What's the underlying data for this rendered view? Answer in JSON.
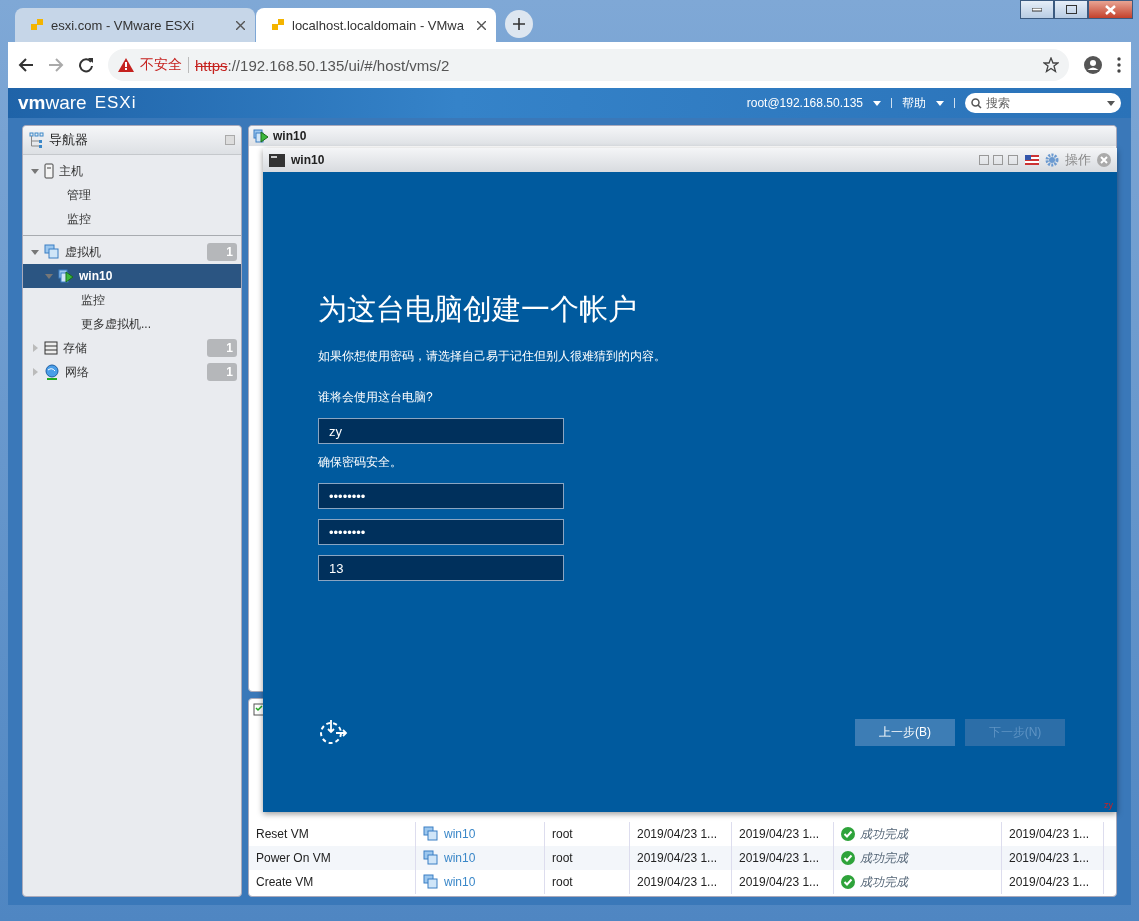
{
  "browser": {
    "tabs": [
      {
        "title": "esxi.com - VMware ESXi",
        "selected": false
      },
      {
        "title": "localhost.localdomain - VMwa",
        "selected": true
      }
    ],
    "address": {
      "security": "不安全",
      "scheme": "https",
      "rest": "://192.168.50.135/ui/#/host/vms/2"
    }
  },
  "esxi_header": {
    "logo_vm": "vm",
    "logo_ware": "ware",
    "product": "ESXi",
    "user": "root@192.168.50.135",
    "help": "帮助",
    "search": {
      "placeholder": "搜索"
    }
  },
  "navigator": {
    "title": "导航器",
    "items": [
      {
        "label": "主机",
        "kind": "host",
        "expanded": true,
        "selected": false,
        "children": [
          {
            "label": "管理",
            "selected": false
          },
          {
            "label": "监控",
            "selected": false
          }
        ]
      },
      {
        "label": "虚拟机",
        "kind": "vms",
        "expanded": true,
        "badge": "1",
        "selected": false,
        "children": [
          {
            "label": "win10",
            "kind": "vm",
            "expanded": true,
            "selected": true,
            "children": [
              {
                "label": "监控",
                "selected": false
              },
              {
                "label": "更多虚拟机...",
                "selected": false
              }
            ]
          }
        ]
      },
      {
        "label": "存储",
        "kind": "storage",
        "expanded": false,
        "badge": "1",
        "selected": false
      },
      {
        "label": "网络",
        "kind": "network",
        "expanded": false,
        "badge": "1",
        "selected": false
      }
    ]
  },
  "vm_panel": {
    "title": "win10"
  },
  "console": {
    "title": "win10",
    "action": "操作",
    "heading": "为这台电脑创建一个帐户",
    "subtitle": "如果你想使用密码，请选择自己易于记住但别人很难猜到的内容。",
    "form": [
      {
        "kind": "label",
        "text": "谁将会使用这台电脑?"
      },
      {
        "kind": "field",
        "text": "zy"
      },
      {
        "kind": "label",
        "text": "确保密码安全。"
      },
      {
        "kind": "field",
        "text": "••••••••"
      },
      {
        "kind": "field",
        "text": "••••••••"
      },
      {
        "kind": "field",
        "text": "13"
      }
    ],
    "buttons": [
      {
        "label": "上一步(B)",
        "disabled": false
      },
      {
        "label": "下一步(N)",
        "disabled": true
      }
    ]
  },
  "corner_label": "zy",
  "tasks": {
    "rows": [
      {
        "task": "Reset VM",
        "target": "win10",
        "initiator": "root",
        "queued": "2019/04/23 1...",
        "started": "2019/04/23 1...",
        "result": "成功完成",
        "completed": "2019/04/23 1..."
      },
      {
        "task": "Power On VM",
        "target": "win10",
        "initiator": "root",
        "queued": "2019/04/23 1...",
        "started": "2019/04/23 1...",
        "result": "成功完成",
        "completed": "2019/04/23 1..."
      },
      {
        "task": "Create VM",
        "target": "win10",
        "initiator": "root",
        "queued": "2019/04/23 1...",
        "started": "2019/04/23 1...",
        "result": "成功完成",
        "completed": "2019/04/23 1..."
      }
    ]
  }
}
